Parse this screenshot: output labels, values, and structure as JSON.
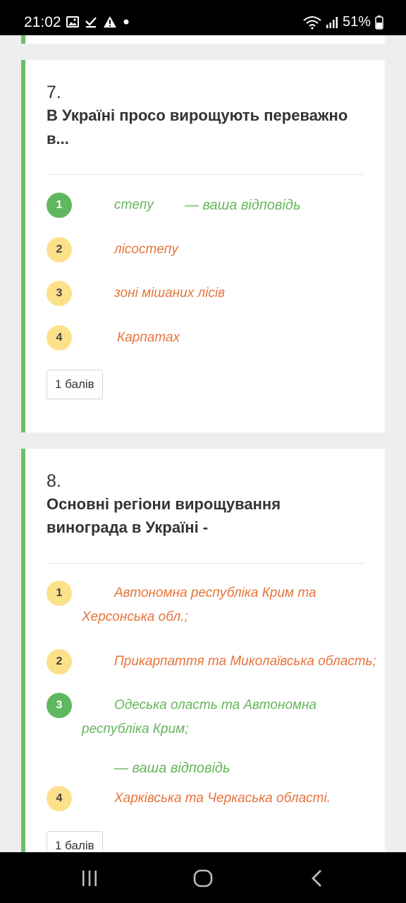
{
  "status_bar": {
    "time": "21:02",
    "battery": "51%",
    "icons": [
      "image-icon",
      "download-done-icon",
      "warning-icon",
      "dot-icon",
      "wifi-icon",
      "signal-icon",
      "battery-icon"
    ]
  },
  "questions": [
    {
      "number": "7.",
      "text": "В Україні просо вирощують переважно в...",
      "options": [
        {
          "num": "1",
          "text": "степу",
          "state": "correct",
          "selected_note": "— ваша відповідь"
        },
        {
          "num": "2",
          "text": "лісостепу",
          "state": "other"
        },
        {
          "num": "3",
          "text": "зоні мішаних лісів",
          "state": "other"
        },
        {
          "num": "4",
          "text": "Карпатах",
          "state": "other"
        }
      ],
      "score": "1 балів"
    },
    {
      "number": "8.",
      "text": "Основні регіони вирощування винограда в Україні -",
      "options": [
        {
          "num": "1",
          "line1": "Автономна республіка Крим та",
          "line2": "Херсонська обл.;",
          "state": "other"
        },
        {
          "num": "2",
          "line1": "Прикарпаття та Миколаївська область;",
          "state": "other"
        },
        {
          "num": "3",
          "line1": "Одеська оласть та Автономна",
          "line2": "республіка Крим;",
          "state": "correct",
          "selected_note": "— ваша відповідь"
        },
        {
          "num": "4",
          "line1": "Харківська та Черкаська області.",
          "state": "other"
        }
      ],
      "score": "1 балів"
    }
  ],
  "colors": {
    "accent_green": "#6cbf6a",
    "correct_text": "#66b55b",
    "other_text": "#e7743b",
    "yellow_circle": "#fde08a",
    "green_circle": "#5fb85f"
  },
  "nav_bar": {
    "buttons": [
      "recent-apps-icon",
      "home-icon",
      "back-icon"
    ]
  }
}
